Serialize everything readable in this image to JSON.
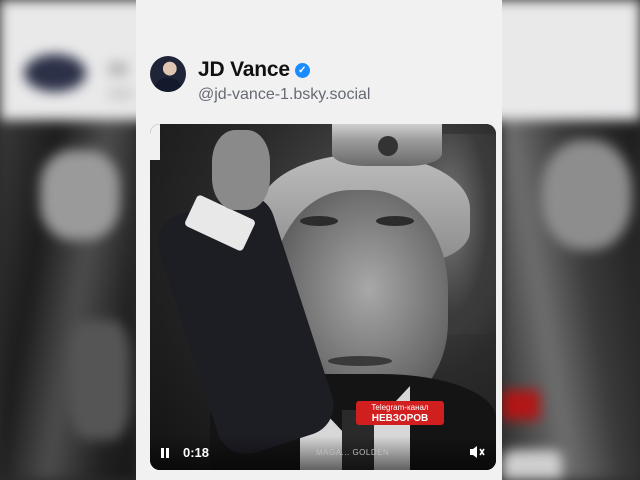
{
  "post": {
    "author_name": "JD Vance",
    "handle": "@jd-vance-1.bsky.social",
    "verified": true
  },
  "video": {
    "elapsed": "0:18",
    "overlay_line1": "Telegram-канал",
    "overlay_line2": "НЕВЗОРОВ",
    "watermark": "MAGA... GOLDEN"
  },
  "icons": {
    "verified": "verified-badge-icon",
    "pause": "pause-icon",
    "mute": "muted-speaker-icon"
  },
  "colors": {
    "verified": "#1a8cff",
    "overlay_red": "#d11e1e",
    "card_bg": "#f1f1f2"
  }
}
